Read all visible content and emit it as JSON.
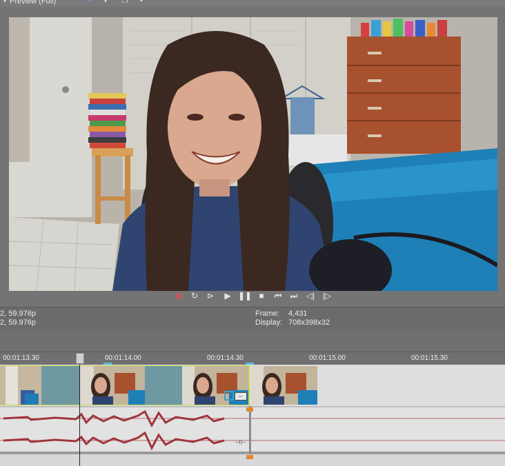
{
  "toolbar": {
    "preview_label": "Preview (Full)"
  },
  "info": {
    "left_line1": "2, 59.976p",
    "left_line2": "2, 59.976p",
    "frame_label": "Frame:",
    "frame_value": "4,431",
    "display_label": "Display:",
    "display_value": "708x398x32"
  },
  "ruler": {
    "ticks": [
      "00:01:13.30",
      "00:01:14.00",
      "00:01:14.30",
      "00:01:15.00",
      "00:01:15.30"
    ]
  },
  "colors": {
    "accent": "#c83232",
    "waveform": "#a0343c",
    "clip_edge": "#c8d84a"
  },
  "icons": [
    "preview-dropdown-icon",
    "grid-icon",
    "copy-snapshot-icon",
    "save-snapshot-icon",
    "record-icon",
    "loop-icon",
    "play-from-start-icon",
    "play-icon",
    "pause-icon",
    "stop-icon",
    "prev-frame-icon",
    "next-frame-icon",
    "prev-marker-icon",
    "next-marker-icon"
  ]
}
